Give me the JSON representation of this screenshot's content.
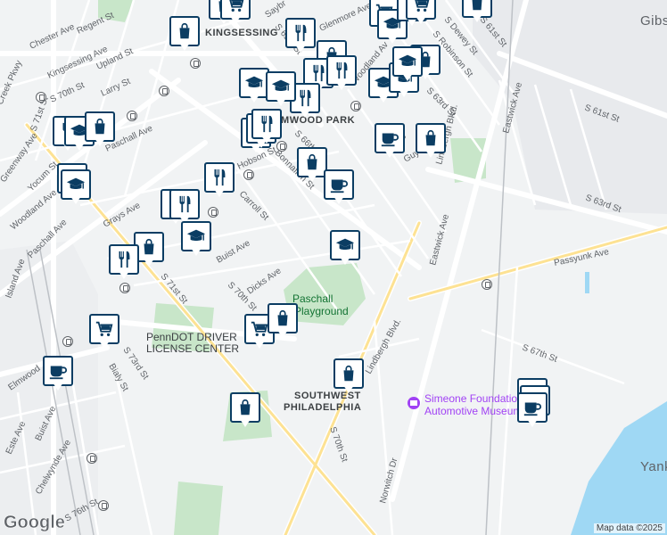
{
  "map": {
    "attribution": "Map data ©2025",
    "logo": "Google",
    "neighborhoods": {
      "kingsessing": "KINGSESSING",
      "elmwood_park": "ELMWOOD PARK",
      "southwest_philadelphia_line1": "SOUTHWEST",
      "southwest_philadelphia_line2": "PHILADELPHIA",
      "gibsonton": "Gibs",
      "yank": "Yank"
    },
    "parks": {
      "paschall_line1": "Paschall",
      "paschall_line2": "Playground"
    },
    "poi": {
      "penndot_line1": "PennDOT DRIVER",
      "penndot_line2": "LICENSE CENTER",
      "simeone_line1": "Simeone Foundation",
      "simeone_line2": "Automotive Museum"
    },
    "streets": {
      "chester_ave": "Chester Ave",
      "regent_st": "Regent St",
      "kingsessing_ave": "Kingsessing Ave",
      "upland_st": "Upland St",
      "creek_pkwy": "Creek Pkwy",
      "s_70th_st_a": "S 70th St",
      "larry_st": "Larry St",
      "s_71st_st_a": "S 71st St",
      "paschall_ave_a": "Paschall Ave",
      "greenway_ave": "Greenway Ave",
      "yocum_st": "Yocum St",
      "woodland_ave": "Woodland Ave",
      "paschall_ave_b": "Paschall Ave",
      "island_ave": "Island Ave",
      "grays_ave": "Grays Ave",
      "carroll_st": "Carroll St",
      "hobson_st": "Hobson St",
      "bonnaffon_st": "Bonnaffon St",
      "s_66th_st": "S 66th St",
      "buist_ave": "Buist Ave",
      "dicks_ave": "Dicks Ave",
      "s_70th_st_b": "S 70th St",
      "s_71st_st_b": "S 71st St",
      "s_73rd_st": "S 73rd St",
      "bialy_st": "Bialy St",
      "elmwood": "Elmwood",
      "buist_ave_b": "Buist Ave",
      "este_ave": "Este Ave",
      "chelwynde_ave": "Chelwynde Ave",
      "s_76th_st": "S 76th St",
      "s_70th_st_c": "S 70th St",
      "norwitch_dr": "Norwitch Dr",
      "lindbergh_blvd_a": "Lindbergh Blvd.",
      "lindbergh_blvd_b": "Lindbergh Blvd.",
      "lindbergh_blvd_c": "Lindbergh Blvd.",
      "eastwick_ave_a": "Eastwick Ave",
      "eastwick_ave_b": "Eastwick Ave",
      "s_61st_st": "S 61st St",
      "s_63rd_st_a": "S 63rd St",
      "s_63rd_st_b": "S 63rd St",
      "passyunk_ave": "Passyunk Ave",
      "s_67th_st": "S 67th St",
      "s_65th_st": "S 65th St",
      "glenmore_ave": "Glenmore Ave",
      "s_dewey_st": "S Dewey St",
      "s_robinson_st": "S Robinson St",
      "s_61st_st_b": "S 61st St",
      "guyer": "Guye",
      "dicks_b": "Dicks",
      "saybrook": "Saybr",
      "woodland_b": "Woodland Av"
    },
    "markers": [
      {
        "type": "shopping-bag",
        "name": "shopping-marker-1"
      },
      {
        "type": "cart",
        "name": "grocery-marker-1"
      },
      {
        "type": "school",
        "name": "school-marker-1"
      },
      {
        "type": "restaurant",
        "name": "restaurant-marker-1"
      },
      {
        "type": "cafe",
        "name": "cafe-marker-1"
      }
    ]
  }
}
